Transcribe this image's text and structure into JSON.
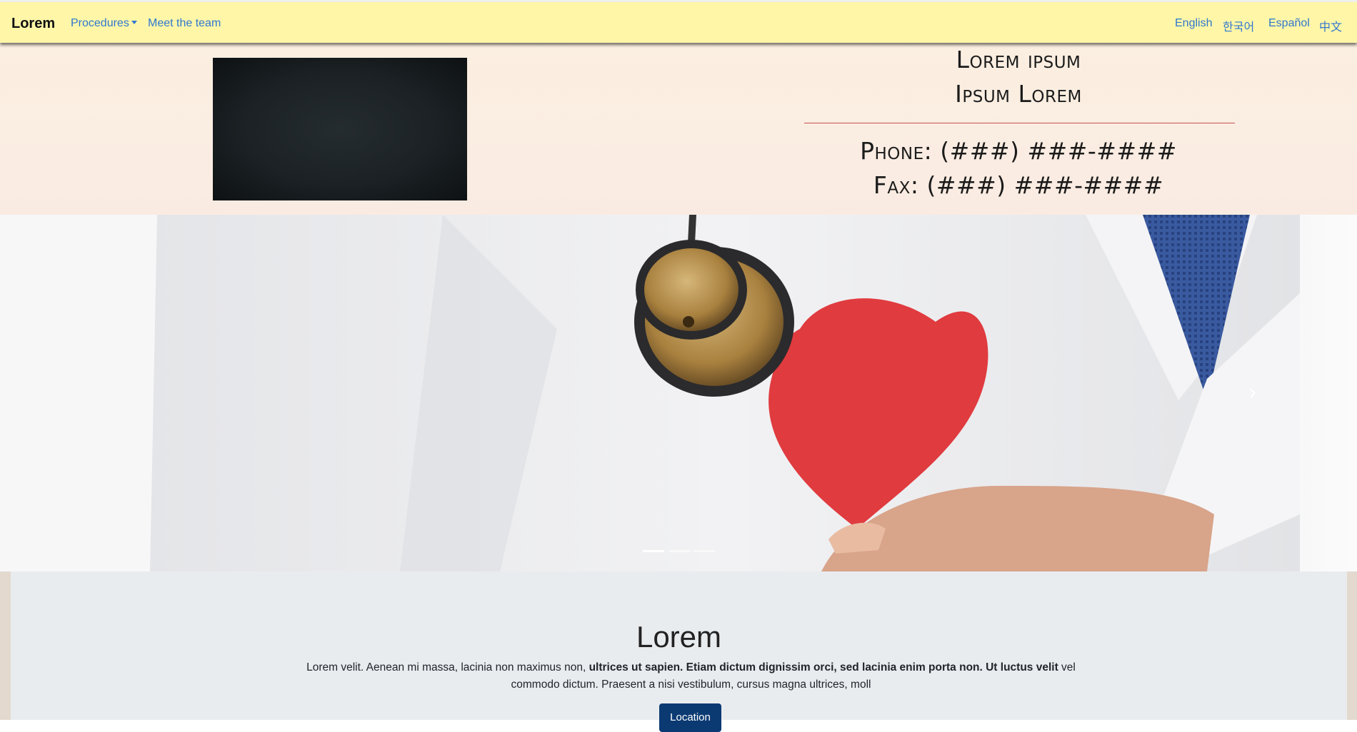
{
  "navbar": {
    "brand": "Lorem",
    "links": {
      "procedures": "Procedures",
      "team": "Meet the team"
    },
    "languages": {
      "english": "English",
      "korean": "한국어",
      "spanish": "Español",
      "chinese": "中文"
    }
  },
  "header": {
    "title_line1": "Lorem ipsum",
    "title_line2": "Ipsum Lorem",
    "phone": "Phone: (###) ###-####",
    "fax": "Fax: (###) ###-####"
  },
  "carousel": {
    "slide_count": 3,
    "active_index": 0,
    "next_icon": "chevron-right-icon"
  },
  "about": {
    "heading": "Lorem",
    "text_plain_1": "Lorem velit. Aenean mi massa, lacinia non maximus non, ",
    "text_bold": "ultrices ut sapien. Etiam dictum dignissim orci, sed lacinia enim porta non. Ut luctus velit",
    "text_plain_2": " vel commodo dictum. Praesent a nisi vestibulum, cursus magna ultrices, moll",
    "button_label": "Location"
  },
  "colors": {
    "navbar_bg": "#fff6a8",
    "link": "#2f78cf",
    "accent_rule": "#c65050",
    "button_bg": "#0b3a73"
  }
}
